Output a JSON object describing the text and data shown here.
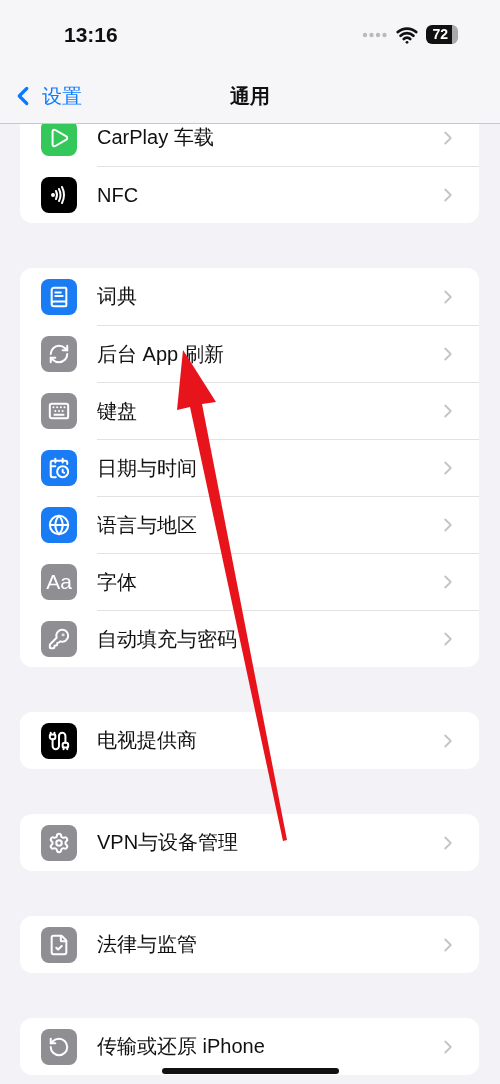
{
  "status_bar": {
    "time": "13:16",
    "battery": "72"
  },
  "nav_bar": {
    "back_label": "设置",
    "title": "通用"
  },
  "groups": [
    {
      "rows": [
        {
          "label": "CarPlay 车载"
        },
        {
          "label": "NFC"
        }
      ]
    },
    {
      "rows": [
        {
          "label": "词典"
        },
        {
          "label": "后台 App 刷新"
        },
        {
          "label": "键盘"
        },
        {
          "label": "日期与时间"
        },
        {
          "label": "语言与地区"
        },
        {
          "label": "字体",
          "icon_text": "Aa"
        },
        {
          "label": "自动填充与密码"
        }
      ]
    },
    {
      "rows": [
        {
          "label": "电视提供商"
        }
      ]
    },
    {
      "rows": [
        {
          "label": "VPN与设备管理"
        }
      ]
    },
    {
      "rows": [
        {
          "label": "法律与监管"
        }
      ]
    },
    {
      "rows": [
        {
          "label": "传输或还原 iPhone"
        }
      ]
    }
  ]
}
